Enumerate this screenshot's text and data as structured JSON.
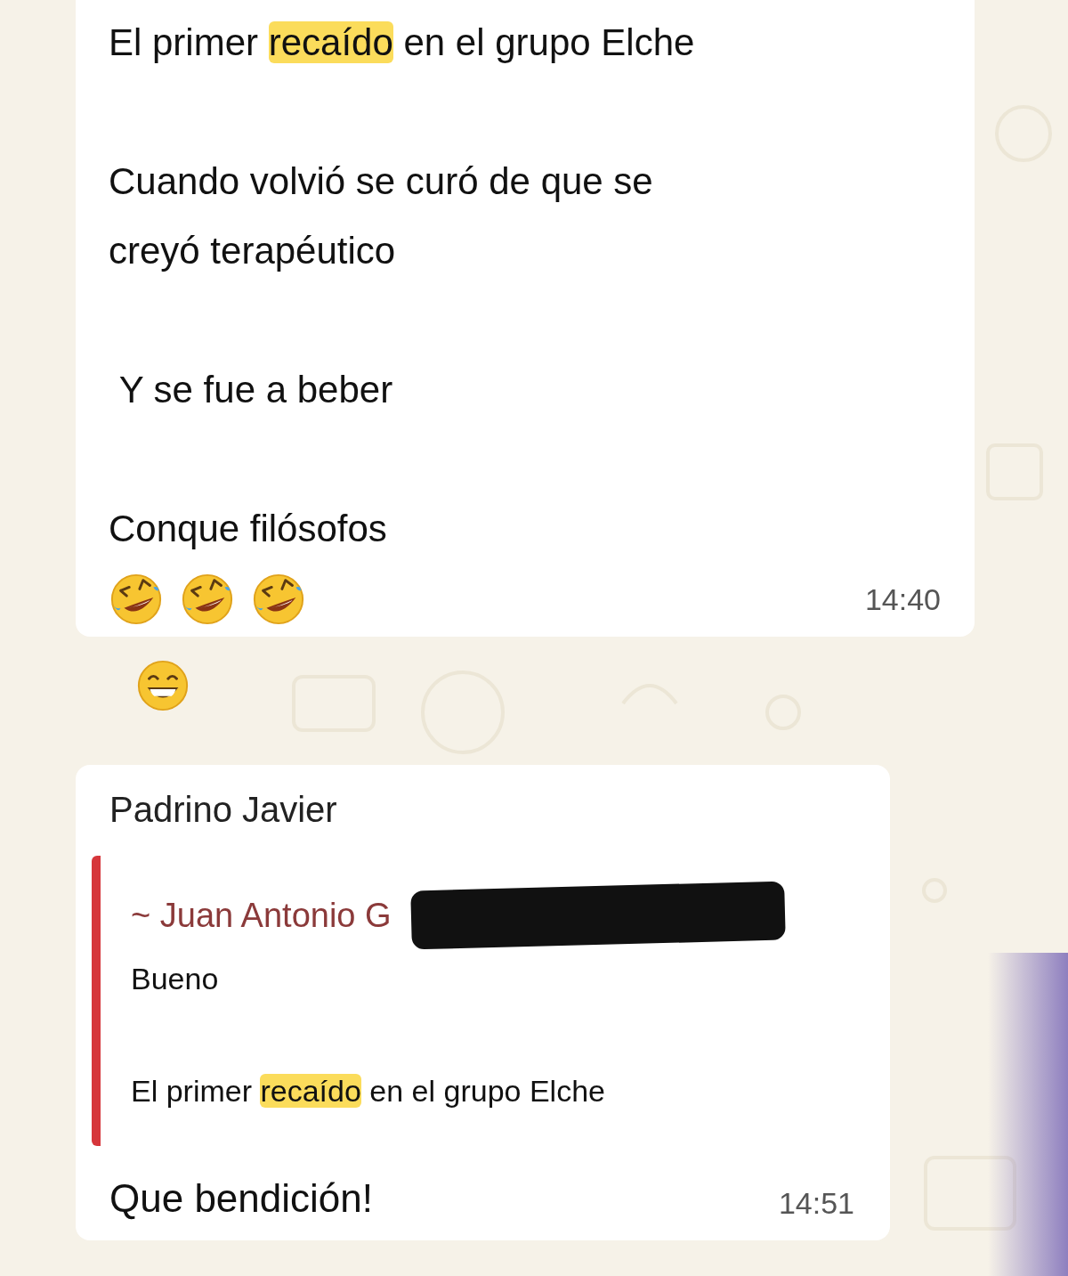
{
  "messages": [
    {
      "kind": "text",
      "paragraphs": [
        [
          {
            "text": "El primer ",
            "highlighted": false
          },
          {
            "text": "recaído",
            "highlighted": true
          },
          {
            "text": " en el grupo Elche",
            "highlighted": false
          }
        ],
        [
          {
            "text": "Cuando volvió se curó de que se creyó terapéutico",
            "highlighted": false
          }
        ],
        [
          {
            "text": " Y se fue a beber",
            "highlighted": false
          }
        ],
        [
          {
            "text": "Conque filósofos",
            "highlighted": false
          }
        ]
      ],
      "emojis": [
        {
          "kind": "rolling-laughing"
        },
        {
          "kind": "rolling-laughing"
        },
        {
          "kind": "rolling-laughing"
        }
      ],
      "time": "14:40"
    },
    {
      "kind": "emoji",
      "emojis": [
        {
          "kind": "grinning"
        }
      ]
    },
    {
      "kind": "reply",
      "sender": "Padrino Javier",
      "quote": {
        "author": "~ Juan Antonio G",
        "redacted": true,
        "paragraphs": [
          [
            {
              "text": "Bueno",
              "highlighted": false
            }
          ],
          [
            {
              "text": "El primer ",
              "highlighted": false
            },
            {
              "text": "recaído",
              "highlighted": true
            },
            {
              "text": " en el grupo Elche",
              "highlighted": false
            }
          ]
        ]
      },
      "text": "Que bendición!",
      "time": "14:51"
    }
  ]
}
